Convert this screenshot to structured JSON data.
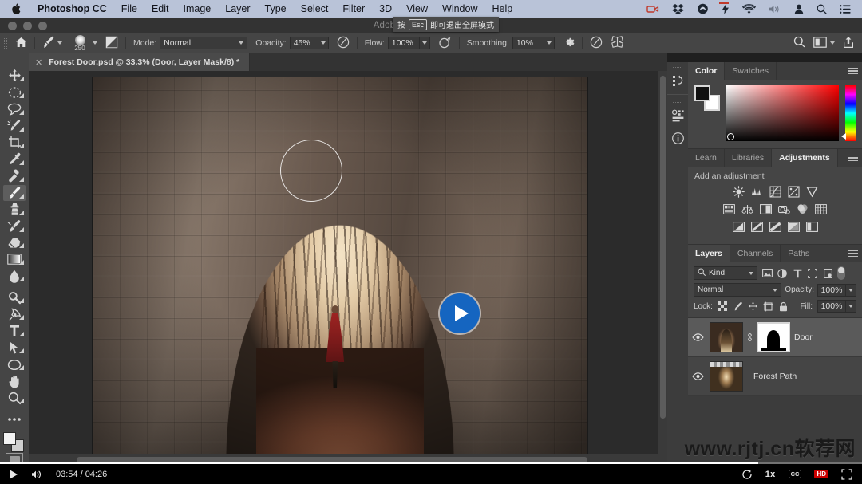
{
  "mac_menu": {
    "apple_icon": "apple-icon",
    "app_name": "Photoshop CC",
    "items": [
      "File",
      "Edit",
      "Image",
      "Layer",
      "Type",
      "Select",
      "Filter",
      "3D",
      "View",
      "Window",
      "Help"
    ],
    "status_icons": [
      "screen-recorder-icon",
      "dropbox-icon",
      "creative-cloud-icon",
      "battery-bolt-icon",
      "wifi-icon",
      "volume-icon",
      "user-icon",
      "spotlight-search-icon",
      "notification-center-icon"
    ]
  },
  "titlebar": {
    "app_title": "Adobe Photoshop CC 2019",
    "tooltip_prefix": "按",
    "tooltip_key": "Esc",
    "tooltip_suffix": "即可退出全屏模式"
  },
  "options_bar": {
    "home_icon": "home-icon",
    "tool_preset_icon": "brush-preset-icon",
    "brush_size": "250",
    "toggle_brush_panel_icon": "brush-panel-icon",
    "mode_label": "Mode:",
    "mode_value": "Normal",
    "opacity_label": "Opacity:",
    "opacity_value": "45%",
    "pressure_opacity_icon": "pressure-opacity-icon",
    "flow_label": "Flow:",
    "flow_value": "100%",
    "airbrush_icon": "airbrush-icon",
    "smoothing_label": "Smoothing:",
    "smoothing_value": "10%",
    "smoothing_options_icon": "gear-icon",
    "angle_icon": "brush-angle-icon",
    "symmetry_icon": "symmetry-butterfly-icon",
    "pressure_size_icon": "pressure-size-icon",
    "search_icon": "search-icon",
    "arrange_icon": "arrange-documents-icon",
    "share_icon": "share-icon"
  },
  "document_tab": {
    "close_icon": "close-icon",
    "title": "Forest Door.psd @ 33.3% (Door, Layer Mask/8) *"
  },
  "toolbar": {
    "tools": [
      {
        "name": "move-tool",
        "icon": "move-icon",
        "active": false
      },
      {
        "name": "elliptical-marquee-tool",
        "icon": "ellipse-marquee-icon",
        "active": false
      },
      {
        "name": "lasso-tool",
        "icon": "lasso-icon",
        "active": false
      },
      {
        "name": "quick-selection-tool",
        "icon": "quick-selection-icon",
        "active": false
      },
      {
        "name": "crop-tool",
        "icon": "crop-icon",
        "active": false
      },
      {
        "name": "eyedropper-tool",
        "icon": "eyedropper-icon",
        "active": false
      },
      {
        "name": "healing-brush-tool",
        "icon": "healing-brush-icon",
        "active": false
      },
      {
        "name": "brush-tool",
        "icon": "brush-icon",
        "active": true
      },
      {
        "name": "clone-stamp-tool",
        "icon": "clone-stamp-icon",
        "active": false
      },
      {
        "name": "history-brush-tool",
        "icon": "history-brush-icon",
        "active": false
      },
      {
        "name": "eraser-tool",
        "icon": "eraser-icon",
        "active": false
      },
      {
        "name": "gradient-tool",
        "icon": "gradient-icon",
        "active": false
      },
      {
        "name": "blur-tool",
        "icon": "blur-droplet-icon",
        "active": false
      },
      {
        "name": "dodge-tool",
        "icon": "dodge-icon",
        "active": false
      },
      {
        "name": "pen-tool",
        "icon": "pen-icon",
        "active": false
      },
      {
        "name": "type-tool",
        "icon": "type-t-icon",
        "active": false
      },
      {
        "name": "path-selection-tool",
        "icon": "path-selection-arrow-icon",
        "active": false
      },
      {
        "name": "ellipse-shape-tool",
        "icon": "ellipse-shape-icon",
        "active": false
      },
      {
        "name": "hand-tool",
        "icon": "hand-icon",
        "active": false
      },
      {
        "name": "zoom-tool",
        "icon": "magnifier-icon",
        "active": false
      },
      {
        "name": "edit-toolbar-button",
        "icon": "ellipsis-icon",
        "active": false
      }
    ],
    "foreground_color": "#f2f2f2",
    "background_color": "#cfcfcf",
    "quick_mask_icon": "quick-mask-icon"
  },
  "canvas": {
    "play_overlay_icon": "play-button-icon",
    "play_overlay_color": "#1565c0",
    "brush_cursor_icon": "brush-cursor-circle"
  },
  "panel_rail": {
    "icons": [
      "history-icon",
      "properties-icon",
      "info-icon"
    ]
  },
  "color_panel": {
    "tabs": [
      {
        "label": "Color",
        "active": true
      },
      {
        "label": "Swatches",
        "active": false
      }
    ],
    "menu_icon": "panel-menu-icon",
    "foreground_swatch": "#111111",
    "background_swatch": "#ffffff",
    "hue_accent": "#ff0000"
  },
  "adjustments_panel": {
    "tabs": [
      {
        "label": "Learn",
        "active": false
      },
      {
        "label": "Libraries",
        "active": false
      },
      {
        "label": "Adjustments",
        "active": true
      }
    ],
    "menu_icon": "panel-menu-icon",
    "heading": "Add an adjustment",
    "row1": [
      "brightness-contrast-icon",
      "levels-icon",
      "curves-icon",
      "exposure-icon",
      "vibrance-icon"
    ],
    "row2": [
      "hue-saturation-icon",
      "color-balance-icon",
      "black-white-icon",
      "photo-filter-icon",
      "channel-mixer-icon",
      "color-lookup-icon"
    ],
    "row3": [
      "invert-icon",
      "posterize-icon",
      "threshold-icon",
      "gradient-map-icon",
      "selective-color-icon"
    ]
  },
  "layers_panel": {
    "tabs": [
      {
        "label": "Layers",
        "active": true
      },
      {
        "label": "Channels",
        "active": false
      },
      {
        "label": "Paths",
        "active": false
      }
    ],
    "menu_icon": "panel-menu-icon",
    "filter_search_icon": "search-icon",
    "filter_kind_value": "Kind",
    "filter_icons": [
      "filter-pixel-icon",
      "filter-adjustment-icon",
      "filter-type-icon",
      "filter-shape-icon",
      "filter-smart-object-icon"
    ],
    "filter_toggle_icon": "filter-toggle-switch",
    "blend_mode": "Normal",
    "opacity_label": "Opacity:",
    "opacity_value": "100%",
    "lock_label": "Lock:",
    "lock_icons": [
      "lock-transparent-pixels-icon",
      "lock-image-pixels-icon",
      "lock-position-icon",
      "lock-artboard-icon",
      "lock-all-icon"
    ],
    "fill_label": "Fill:",
    "fill_value": "100%",
    "layers": [
      {
        "name": "Door",
        "selected": true,
        "visible": true,
        "eye_icon": "eye-icon",
        "has_mask": true,
        "link_icon": "link-icon",
        "thumb": "door-archway-thumbnail",
        "mask_thumb": "layer-mask-arch-thumbnail"
      },
      {
        "name": "Forest Path",
        "selected": false,
        "visible": true,
        "eye_icon": "eye-icon",
        "has_mask": false,
        "thumb": "forest-path-thumbnail"
      }
    ]
  },
  "watermark": {
    "text": "www.rjtj.cn软荐网"
  },
  "player": {
    "play_icon": "play-icon",
    "volume_icon": "volume-icon",
    "time_current": "03:54",
    "time_total": "04:26",
    "time_display": "03:54 / 04:26",
    "replay_icon": "replay-icon",
    "speed_label": "1x",
    "captions_label": "CC",
    "quality_label": "HD",
    "fullscreen_icon": "fullscreen-icon",
    "progress_percent": 88
  }
}
